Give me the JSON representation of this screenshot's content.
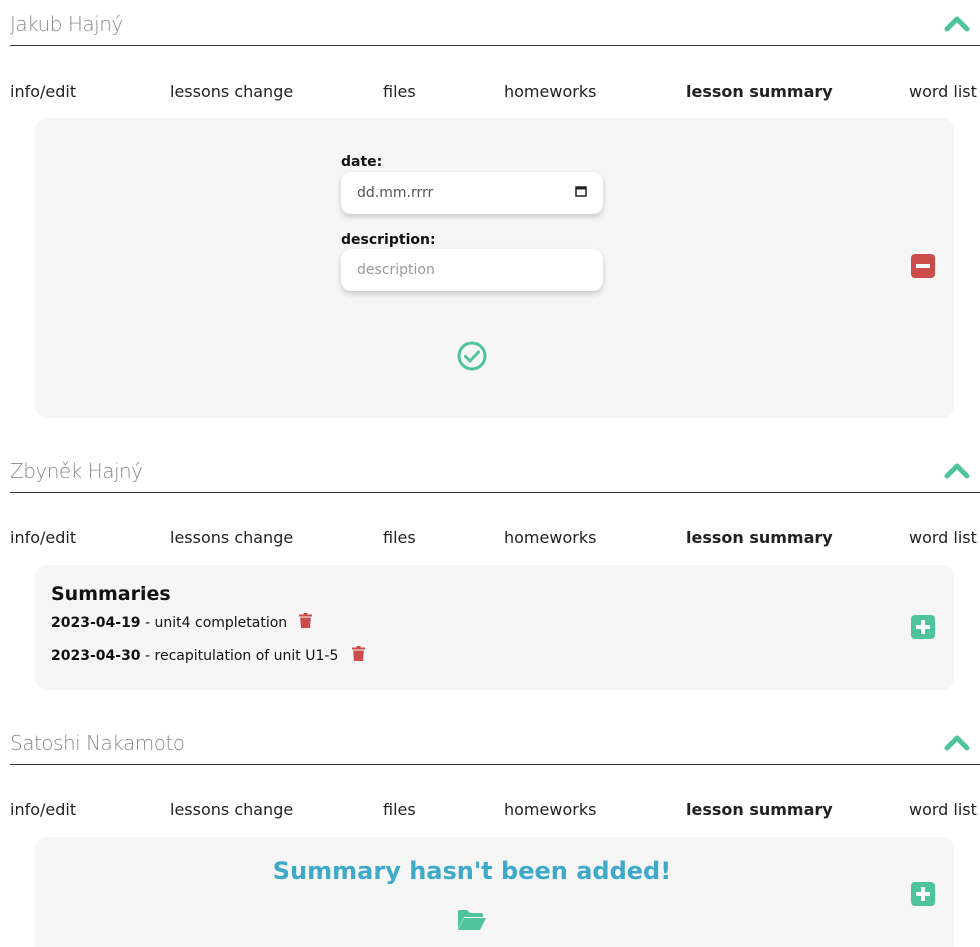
{
  "tabs": [
    "info/edit",
    "lessons change",
    "files",
    "homeworks",
    "lesson summary",
    "word list"
  ],
  "active_tab": "lesson summary",
  "colors": {
    "accent_green": "#4fc39b",
    "danger_red": "#cc4b4b",
    "empty_blue": "#3fa9c9",
    "panel_bg": "#f6f6f6"
  },
  "students": [
    {
      "name": "Jakub Hajný",
      "form": {
        "date_label": "date:",
        "date_value": "dd.mm.rrrr",
        "description_label": "description:",
        "description_placeholder": "description"
      },
      "icons": [
        "collapse-icon",
        "calendar-icon",
        "confirm-check-icon",
        "remove-minus-icon"
      ]
    },
    {
      "name": "Zbyněk Hajný",
      "summaries_title": "Summaries",
      "summaries": [
        {
          "date": "2023-04-19",
          "text": " - unit4 completation"
        },
        {
          "date": "2023-04-30",
          "text": " - recapitulation of unit U1-5"
        }
      ],
      "icons": [
        "collapse-icon",
        "trash-icon",
        "add-plus-icon"
      ]
    },
    {
      "name": "Satoshi Nakamoto",
      "empty_message": "Summary hasn't been added!",
      "icons": [
        "collapse-icon",
        "open-folder-icon",
        "add-plus-icon"
      ]
    }
  ]
}
